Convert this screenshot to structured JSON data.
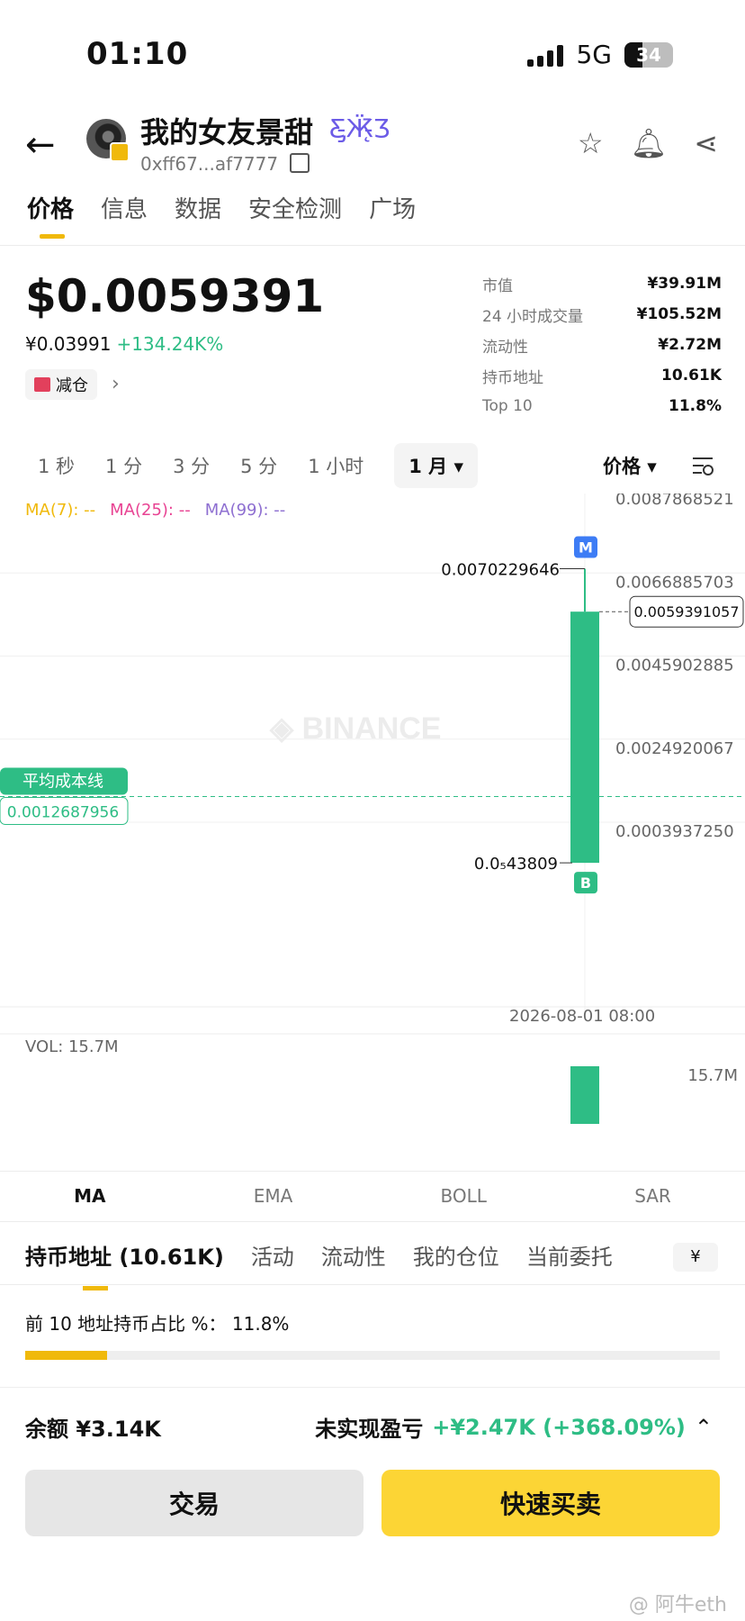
{
  "status": {
    "time": "01:10",
    "network": "5G",
    "battery": "34"
  },
  "token": {
    "name": "我的女友景甜",
    "address": "0xff67...af7777"
  },
  "tabs": [
    "价格",
    "信息",
    "数据",
    "安全检测",
    "广场"
  ],
  "price": {
    "usd": "$0.0059391",
    "cny": "¥0.03991",
    "change": "+134.24K%",
    "reduce_label": "减仓"
  },
  "stats": [
    {
      "k": "市值",
      "v": "¥39.91M"
    },
    {
      "k": "24 小时成交量",
      "v": "¥105.52M"
    },
    {
      "k": "流动性",
      "v": "¥2.72M"
    },
    {
      "k": "持币地址",
      "v": "10.61K"
    },
    {
      "k": "Top 10",
      "v": "11.8%"
    }
  ],
  "intervals": [
    "1 秒",
    "1 分",
    "3 分",
    "5 分",
    "1 小时",
    "1 月 ▾"
  ],
  "price_select": "价格 ▾",
  "ma": {
    "ma7": "MA(7): --",
    "ma25": "MA(25): --",
    "ma99": "MA(99): --"
  },
  "chart_data": {
    "type": "candlestick",
    "y_ticks": [
      "0.0087868521",
      "0.0066885703",
      "0.0045902885",
      "0.0024920067",
      "0.0003937250"
    ],
    "y_tick_values": [
      0.0087868521,
      0.0066885703,
      0.0045902885,
      0.0024920067,
      0.000393725
    ],
    "candle": {
      "time": "2026-08-01 08:00",
      "open": 4.3809e-06,
      "high": 0.0070229646,
      "low": 4.3809e-06,
      "close": 0.0059391057
    },
    "high_label": "0.0070229646",
    "low_label": "0.0₅43809",
    "current_label": "0.0059391057",
    "avg_cost": {
      "label": "平均成本线",
      "value": "0.0012687956",
      "v": 0.0012687956
    },
    "markers": {
      "high": "M",
      "low": "B"
    },
    "watermark": "BINANCE",
    "volume": {
      "label": "VOL: 15.7M",
      "value": "15.7M",
      "tick_top": "15.7M",
      "tick_bottom": "15.7M"
    }
  },
  "indicator_tabs": [
    "MA",
    "EMA",
    "BOLL",
    "SAR"
  ],
  "sub_tabs": [
    "持币地址 (10.61K)",
    "活动",
    "流动性",
    "我的仓位",
    "当前委托"
  ],
  "currency_chip": "¥",
  "top10": {
    "text": "前 10 地址持币占比 %： 11.8%",
    "fraction": 0.118
  },
  "balance": "余额 ¥3.14K",
  "pnl": {
    "label": "未实现盈亏",
    "value": "+¥2.47K (+368.09%)"
  },
  "buttons": {
    "trade": "交易",
    "quick": "快速买卖"
  },
  "watermark": "@ 阿牛eth"
}
